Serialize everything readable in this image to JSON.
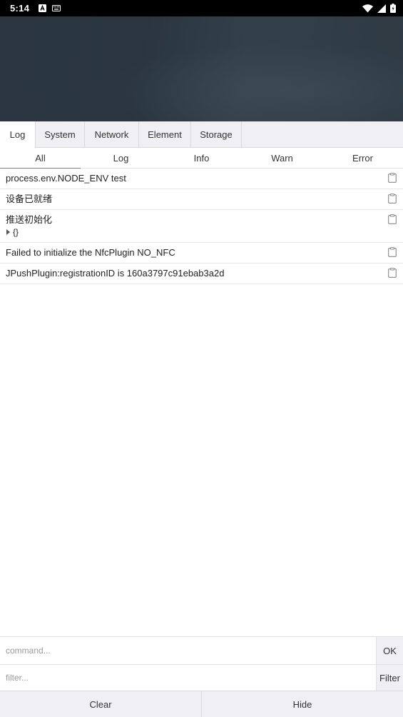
{
  "status_bar": {
    "time": "5:14",
    "icons": [
      "a-notification-icon",
      "keyboard-icon",
      "wifi-icon",
      "signal-icon",
      "battery-icon"
    ]
  },
  "tabs": [
    {
      "label": "Log",
      "active": true
    },
    {
      "label": "System",
      "active": false
    },
    {
      "label": "Network",
      "active": false
    },
    {
      "label": "Element",
      "active": false
    },
    {
      "label": "Storage",
      "active": false
    }
  ],
  "subtabs": [
    {
      "label": "All",
      "active": true
    },
    {
      "label": "Log",
      "active": false
    },
    {
      "label": "Info",
      "active": false
    },
    {
      "label": "Warn",
      "active": false
    },
    {
      "label": "Error",
      "active": false
    }
  ],
  "logs": [
    {
      "text": "process.env.NODE_ENV test"
    },
    {
      "text": "设备已就绪"
    },
    {
      "text": "推送初始化",
      "object": "{}"
    },
    {
      "text": "Failed to initialize the NfcPlugin NO_NFC"
    },
    {
      "text": "JPushPlugin:registrationID is 160a3797c91ebab3a2d"
    }
  ],
  "command": {
    "placeholder": "command...",
    "button": "OK"
  },
  "filter": {
    "placeholder": "filter...",
    "button": "Filter"
  },
  "toolbar": {
    "clear": "Clear",
    "hide": "Hide"
  },
  "colors": {
    "accent": "#2196f3",
    "tabbar_bg": "#efeff4"
  }
}
